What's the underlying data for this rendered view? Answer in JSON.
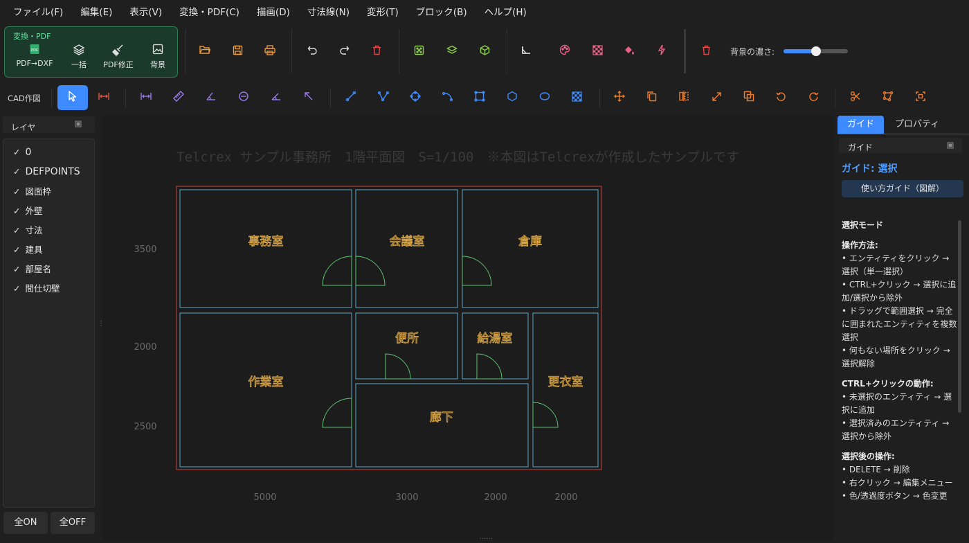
{
  "menu": [
    "ファイル(F)",
    "編集(E)",
    "表示(V)",
    "変換・PDF(C)",
    "描画(D)",
    "寸法線(N)",
    "変形(T)",
    "ブロック(B)",
    "ヘルプ(H)"
  ],
  "ribbon": {
    "convert_title": "変換・PDF",
    "convert_buttons": [
      {
        "label": "PDF→DXF",
        "icon": "pdf-file-icon"
      },
      {
        "label": "一括",
        "icon": "layers-stack-icon"
      },
      {
        "label": "PDF修正",
        "icon": "broom-icon"
      },
      {
        "label": "背景",
        "icon": "image-icon"
      }
    ],
    "bg_label": "背景の濃さ:",
    "bg_level": 0.5
  },
  "toolbar": {
    "cad_label": "CAD作図"
  },
  "layers": {
    "title": "レイヤ",
    "items": [
      "0",
      "DEFPOINTS",
      "図面枠",
      "外壁",
      "寸法",
      "建具",
      "部屋名",
      "間仕切壁"
    ],
    "all_on": "全ON",
    "all_off": "全OFF"
  },
  "drawing": {
    "title": "Telcrex サンプル事務所　1階平面図　S=1/100　※本図はTelcrexが作成したサンプルです",
    "rooms": [
      "事務室",
      "会議室",
      "倉庫",
      "便所",
      "給湯室",
      "作業室",
      "更衣室",
      "廊下"
    ],
    "dims_left": [
      "3500",
      "2000",
      "2500"
    ],
    "dims_bottom": [
      "5000",
      "3000",
      "2000",
      "2000"
    ]
  },
  "guide": {
    "tabs": [
      "ガイド",
      "プロパティ"
    ],
    "subhead": "ガイド",
    "title": "ガイド: 選択",
    "howto_button": "使い方ガイド（図解）",
    "lines": [
      {
        "t": "選択モード",
        "h": true
      },
      {
        "t": "",
        "h": false
      },
      {
        "t": "操作方法:",
        "h": true
      },
      {
        "t": "• エンティティをクリック → 選択（単一選択）",
        "h": false
      },
      {
        "t": "• CTRL+クリック → 選択に追加/選択から除外",
        "h": false
      },
      {
        "t": "• ドラッグで範囲選択 → 完全に囲まれたエンティティを複数選択",
        "h": false
      },
      {
        "t": "• 何もない場所をクリック → 選択解除",
        "h": false
      },
      {
        "t": "",
        "h": false
      },
      {
        "t": "CTRL+クリックの動作:",
        "h": true
      },
      {
        "t": "• 未選択のエンティティ → 選択に追加",
        "h": false
      },
      {
        "t": "• 選択済みのエンティティ → 選択から除外",
        "h": false
      },
      {
        "t": "",
        "h": false
      },
      {
        "t": "選択後の操作:",
        "h": true
      },
      {
        "t": "• DELETE → 削除",
        "h": false
      },
      {
        "t": "• 右クリック → 編集メニュー",
        "h": false
      },
      {
        "t": "• 色/透過度ボタン → 色変更",
        "h": false
      }
    ]
  },
  "colors": {
    "accent": "#3d8bff",
    "frame": "#c8423c",
    "wall": "#5fa8c8",
    "door": "#5cc46e",
    "room_label": "#d9a441",
    "dim": "#6a6a6a"
  }
}
